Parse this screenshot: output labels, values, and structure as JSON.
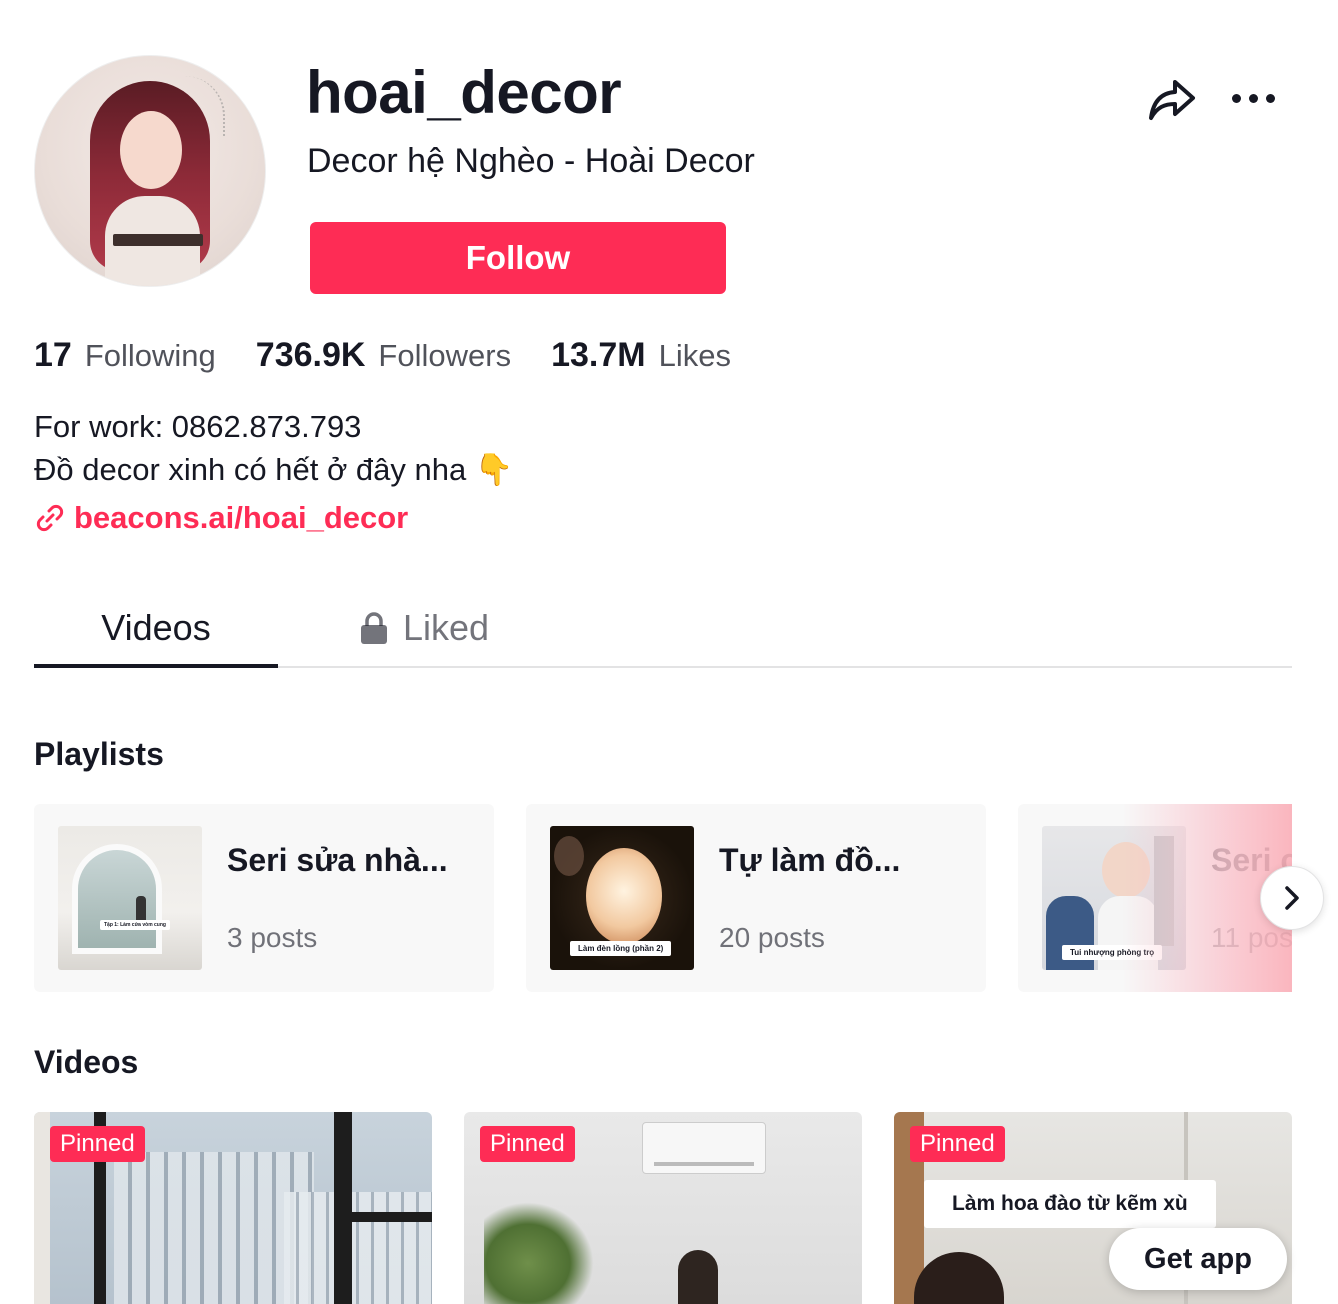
{
  "profile": {
    "username": "hoai_decor",
    "nickname": "Decor hệ Nghèo - Hoài Decor",
    "follow_label": "Follow"
  },
  "stats": {
    "following_count": "17",
    "following_label": "Following",
    "followers_count": "736.9K",
    "followers_label": "Followers",
    "likes_count": "13.7M",
    "likes_label": "Likes"
  },
  "bio": {
    "line1": "For work: 0862.873.793",
    "line2": "Đồ decor xinh có hết ở đây nha 👇",
    "link": "beacons.ai/hoai_decor"
  },
  "tabs": [
    {
      "label": "Videos",
      "active": true
    },
    {
      "label": "Liked",
      "locked": true
    }
  ],
  "sections": {
    "playlists_title": "Playlists",
    "videos_title": "Videos"
  },
  "playlists": [
    {
      "title": "Seri sửa nhà...",
      "count": "3 posts",
      "thumb_caption": "Tập 1: Làm cửa vòm cung"
    },
    {
      "title": "Tự làm đồ...",
      "count": "20 posts",
      "thumb_caption": "Làm đèn lồng (phần 2)"
    },
    {
      "title": "Seri c",
      "count": "11 pos",
      "thumb_caption": "Tui nhượng phòng trọ"
    }
  ],
  "videos": [
    {
      "badge": "Pinned"
    },
    {
      "badge": "Pinned"
    },
    {
      "badge": "Pinned",
      "caption": "Làm hoa đào từ kẽm xù"
    }
  ],
  "get_app_label": "Get app",
  "colors": {
    "accent": "#fe2c55",
    "text": "#161823",
    "card_bg": "#f8f8f8"
  },
  "icons": [
    "share-icon",
    "more-icon",
    "link-icon",
    "lock-icon",
    "chevron-right-icon"
  ]
}
